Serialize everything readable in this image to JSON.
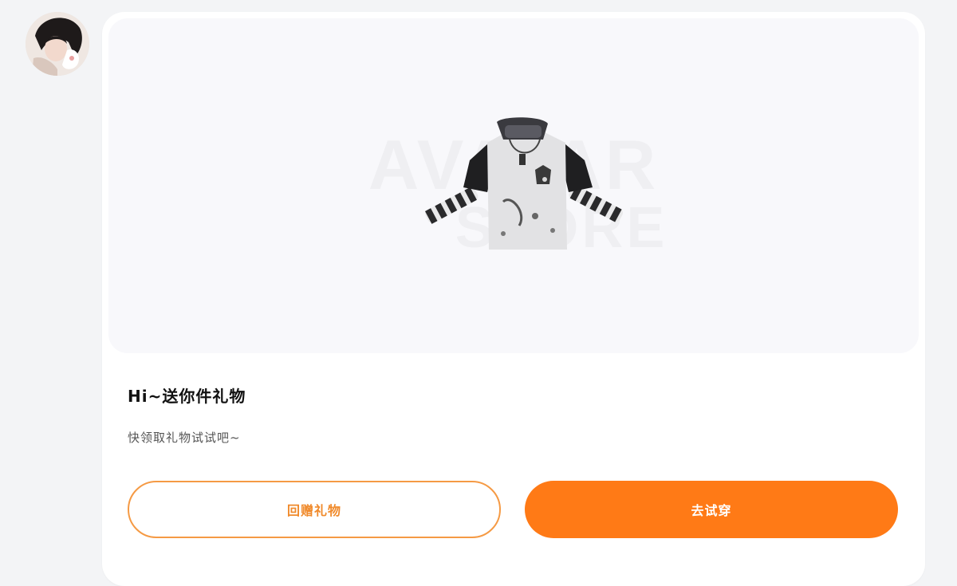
{
  "message": {
    "title": "Hi~送你件礼物",
    "subtitle": "快领取礼物试试吧~",
    "buttons": {
      "return_gift": "回赠礼物",
      "try_on": "去试穿"
    },
    "preview": {
      "watermark_line1": "AVATAR",
      "watermark_line2": "STORE"
    }
  },
  "colors": {
    "accent": "#ff7a16",
    "accent_border": "#f59a44"
  }
}
